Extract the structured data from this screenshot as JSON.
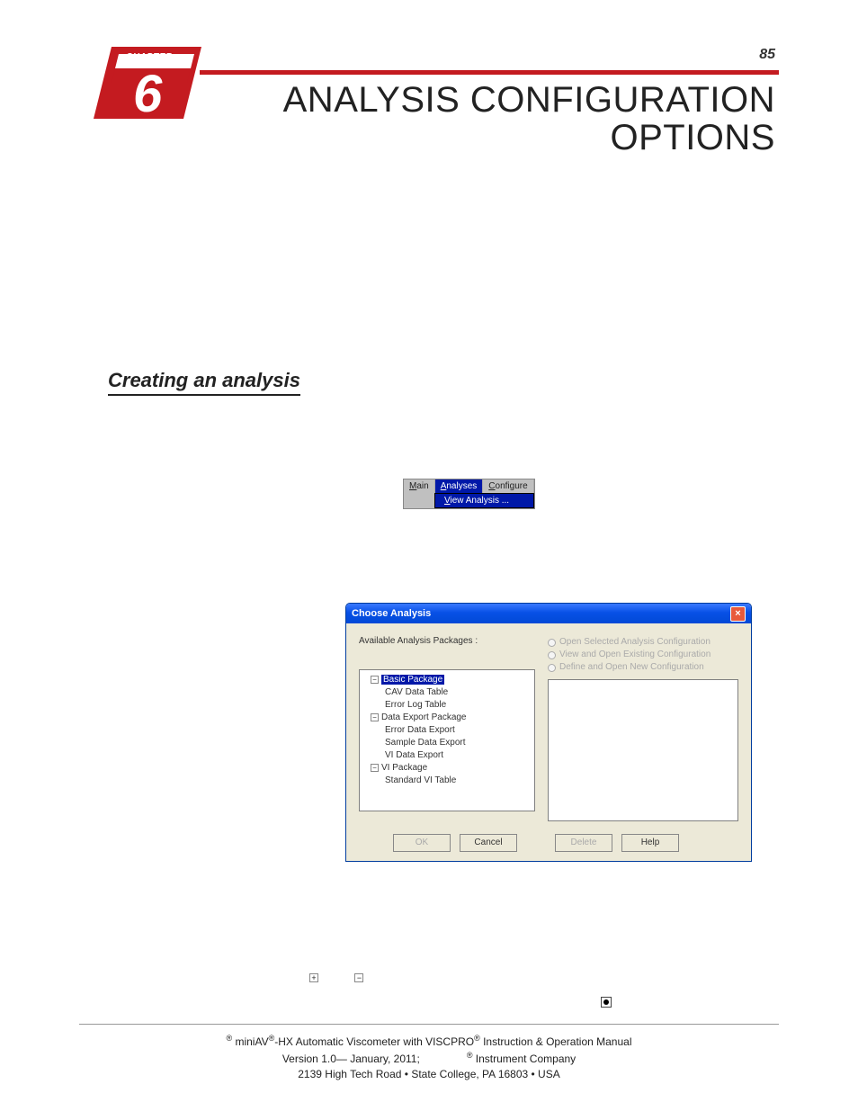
{
  "page_number": "85",
  "chapter": {
    "label": "CHAPTER",
    "number": "6"
  },
  "title_line1": "ANALYSIS CONFIGURATION",
  "title_line2": "OPTIONS",
  "section_heading": "Creating an analysis",
  "menubar": {
    "items": [
      {
        "label": "Main",
        "mnemonic_index": 0
      },
      {
        "label": "Analyses",
        "mnemonic_index": 0,
        "selected": true
      },
      {
        "label": "Configure",
        "mnemonic_index": 0
      }
    ],
    "submenu_label": "View Analysis ...",
    "submenu_mnemonic_index": 0
  },
  "dialog": {
    "title": "Choose Analysis",
    "available_label": "Available Analysis Packages :",
    "tree": [
      {
        "label": "Basic Package",
        "selected": true,
        "expanded": true,
        "children": [
          "CAV Data Table",
          "Error Log Table"
        ]
      },
      {
        "label": "Data Export Package",
        "expanded": true,
        "children": [
          "Error Data Export",
          "Sample Data Export",
          "VI Data Export"
        ]
      },
      {
        "label": "VI Package",
        "expanded": true,
        "children": [
          "Standard VI Table"
        ]
      }
    ],
    "radios": [
      "Open Selected Analysis Configuration",
      "View and Open Existing Configuration",
      "Define and Open New Configuration"
    ],
    "buttons": {
      "ok": "OK",
      "cancel": "Cancel",
      "delete": "Delete",
      "help": "Help"
    }
  },
  "footer": {
    "line1_pre": " miniAV",
    "line1_mid": "-HX Automatic Viscometer with VISCPRO",
    "line1_post": " Instruction & Operation Manual",
    "line2_pre": "Version 1.0— January, 2011;",
    "line2_post": " Instrument Company",
    "line3": "2139 High Tech Road • State College, PA  16803 • USA"
  }
}
